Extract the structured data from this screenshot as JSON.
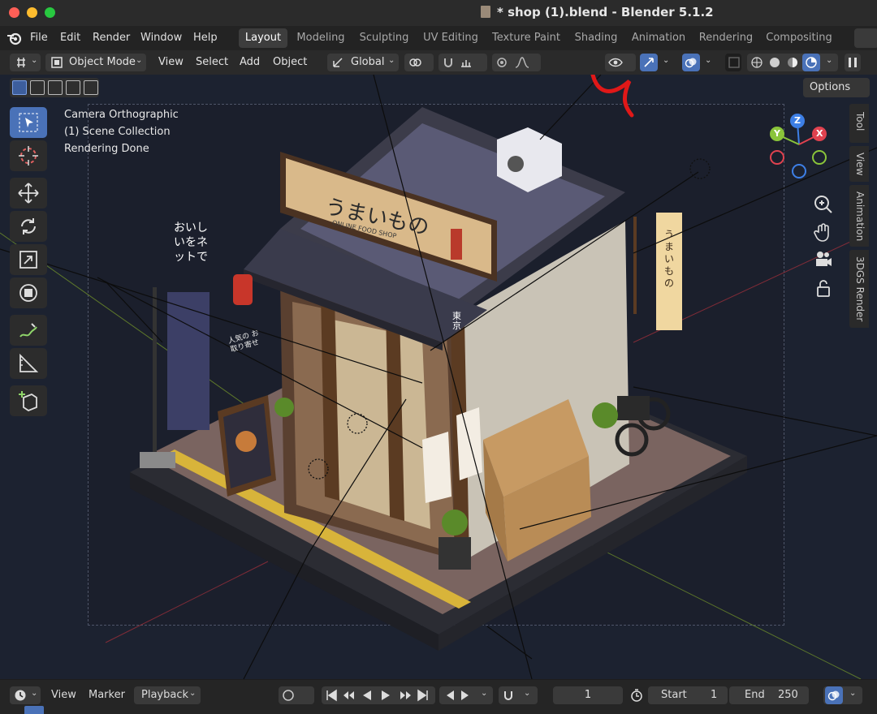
{
  "window": {
    "title": "* shop (1).blend - Blender 5.1.2"
  },
  "menu": {
    "items": [
      "File",
      "Edit",
      "Render",
      "Window",
      "Help"
    ]
  },
  "workspaces": {
    "tabs": [
      "Layout",
      "Modeling",
      "Sculpting",
      "UV Editing",
      "Texture Paint",
      "Shading",
      "Animation",
      "Rendering",
      "Compositing"
    ],
    "active": "Layout"
  },
  "viewport_header": {
    "mode": "Object Mode",
    "menus": [
      "View",
      "Select",
      "Add",
      "Object"
    ],
    "transform_orientation": "Global",
    "options_label": "Options"
  },
  "viewport_overlay": {
    "camera": "Camera Orthographic",
    "collection": "(1) Scene Collection",
    "status": "Rendering Done"
  },
  "side_tabs": [
    "Tool",
    "View",
    "Animation",
    "3DGS Render"
  ],
  "gizmo": {
    "axes": [
      "X",
      "Y",
      "Z"
    ],
    "colors": {
      "x": "#e0424f",
      "y": "#8ac43a",
      "z": "#3d7fe6"
    }
  },
  "scene": {
    "sign_main": "うまいもの",
    "sign_sub": "ONLINE FOOD SHOP",
    "sign_tag": "東京",
    "banner_text": "おいしいをネットで",
    "hanging_sign": "うまいもの",
    "board_text": "人気の お取り寄せ"
  },
  "timeline": {
    "menus": [
      "View",
      "Marker",
      "Playback"
    ],
    "current_frame": "1",
    "start_label": "Start",
    "start_value": "1",
    "end_label": "End",
    "end_value": "250"
  },
  "colors": {
    "accent": "#4a72b8",
    "viewport_bg": "#1c2230",
    "panel": "#2a2a2a"
  }
}
